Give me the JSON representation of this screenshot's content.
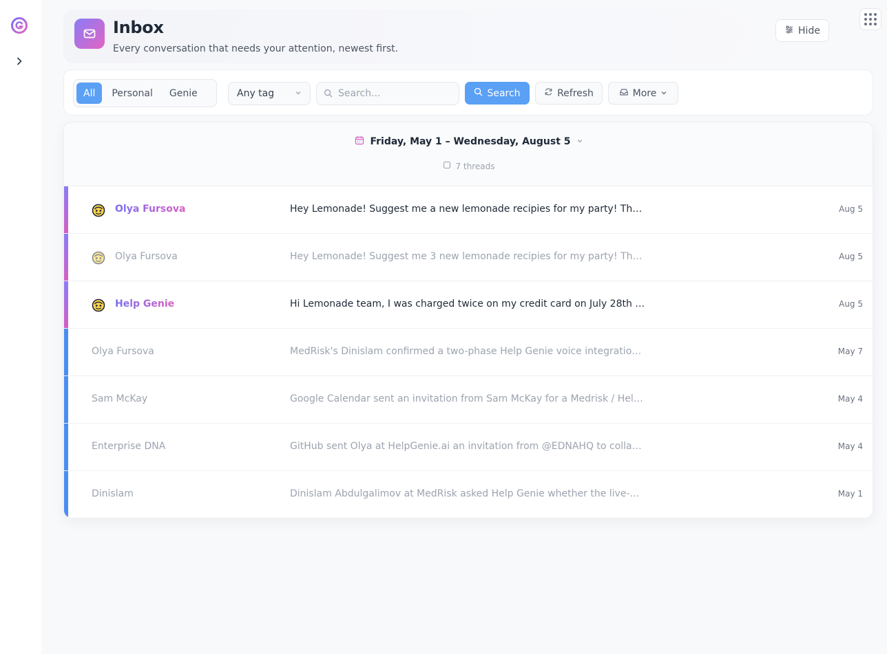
{
  "colors": {
    "accent_blue": "#5aa0f5",
    "accent_purple": "#8b7cf6",
    "accent_pink": "#e164c4",
    "unread_bar": "#d45fc6",
    "read_bar": "#4b8ef2"
  },
  "rail": {
    "logo_icon": "genie-logo-icon",
    "expand_icon": "chevron-right-icon"
  },
  "header": {
    "icon": "mail-icon",
    "title": "Inbox",
    "subtitle": "Every conversation that needs your attention, newest first.",
    "hide_label": "Hide",
    "hide_icon": "sliders-icon",
    "apps_icon": "grid-dots-icon"
  },
  "toolbar": {
    "filters": [
      {
        "label": "All",
        "active": true
      },
      {
        "label": "Personal",
        "active": false
      },
      {
        "label": "Genie",
        "active": false
      }
    ],
    "tag_select": "Any tag",
    "search_placeholder": "Search...",
    "search_label": "Search",
    "refresh_label": "Refresh",
    "more_label": "More"
  },
  "list": {
    "date_range": "Friday, May 1 – Wednesday, August 5",
    "thread_count": "7 threads",
    "threads": [
      {
        "sender": "Olya Fursova",
        "subject": "Hey Lemonade! Suggest me a new lemonade recipies for my party! Th…",
        "date": "Aug 5",
        "unread": true,
        "genie": true,
        "avatar": true
      },
      {
        "sender": "Olya Fursova",
        "subject": "Hey Lemonade! Suggest me 3 new lemonade recipies for my party! Tha…",
        "date": "Aug 5",
        "unread": false,
        "genie": true,
        "avatar": true
      },
      {
        "sender": "Help Genie",
        "subject": "Hi Lemonade team, I was charged twice on my credit card on July 28th …",
        "date": "Aug 5",
        "unread": true,
        "genie": true,
        "avatar": true
      },
      {
        "sender": "Olya Fursova",
        "subject": "MedRisk's Dinislam confirmed a two-phase Help Genie voice integration…",
        "date": "May 7",
        "unread": false,
        "genie": false,
        "avatar": false
      },
      {
        "sender": "Sam McKay",
        "subject": "Google Calendar sent an invitation from Sam McKay for a Medrisk / Hel…",
        "date": "May 4",
        "unread": false,
        "genie": false,
        "avatar": false
      },
      {
        "sender": "Enterprise DNA",
        "subject": "GitHub sent Olya at HelpGenie.ai an invitation from @EDNAHQ to collabo…",
        "date": "May 4",
        "unread": false,
        "genie": false,
        "avatar": false
      },
      {
        "sender": "Dinislam",
        "subject": "Dinislam Abdulgalimov at MedRisk asked Help Genie whether the live-a…",
        "date": "May 1",
        "unread": false,
        "genie": false,
        "avatar": false
      }
    ]
  }
}
